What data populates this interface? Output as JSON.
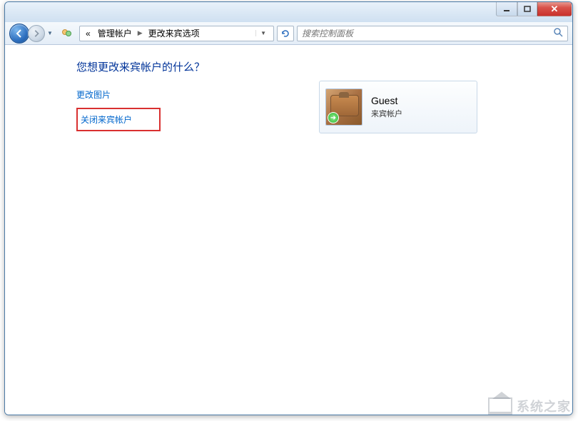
{
  "breadcrumb": {
    "prefix": "«",
    "item1": "管理帐户",
    "item2": "更改来宾选项"
  },
  "search": {
    "placeholder": "搜索控制面板"
  },
  "page": {
    "title": "您想更改来宾帐户的什么？",
    "action_change_picture": "更改图片",
    "action_turn_off_guest": "关闭来宾帐户"
  },
  "account": {
    "name": "Guest",
    "type": "来宾帐户"
  },
  "watermark": "系统之家"
}
